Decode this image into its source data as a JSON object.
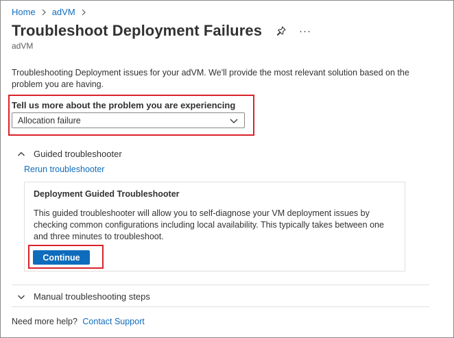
{
  "breadcrumb": {
    "items": [
      "Home",
      "adVM"
    ]
  },
  "header": {
    "title": "Troubleshoot Deployment Failures",
    "subtitle": "adVM",
    "more_glyph": "···"
  },
  "description": "Troubleshooting Deployment issues for your adVM. We'll provide the most relevant solution based on the problem you are having.",
  "problem": {
    "label": "Tell us more about the problem you are experiencing",
    "selected": "Allocation failure"
  },
  "guided": {
    "header": "Guided troubleshooter",
    "rerun_link": "Rerun troubleshooter",
    "card_title": "Deployment Guided Troubleshooter",
    "card_text": "This guided troubleshooter will allow you to self-diagnose your VM deployment issues by checking common configurations including local availability. This typically takes between one and three minutes to troubleshoot.",
    "continue_label": "Continue"
  },
  "manual": {
    "header": "Manual troubleshooting steps"
  },
  "help": {
    "text": "Need more help?",
    "link": "Contact Support"
  },
  "colors": {
    "accent": "#0f6cbd",
    "highlight": "#d9222a"
  },
  "icons": [
    "chevron-right-icon",
    "pin-icon",
    "more-icon",
    "chevron-down-icon",
    "chevron-up-icon"
  ]
}
